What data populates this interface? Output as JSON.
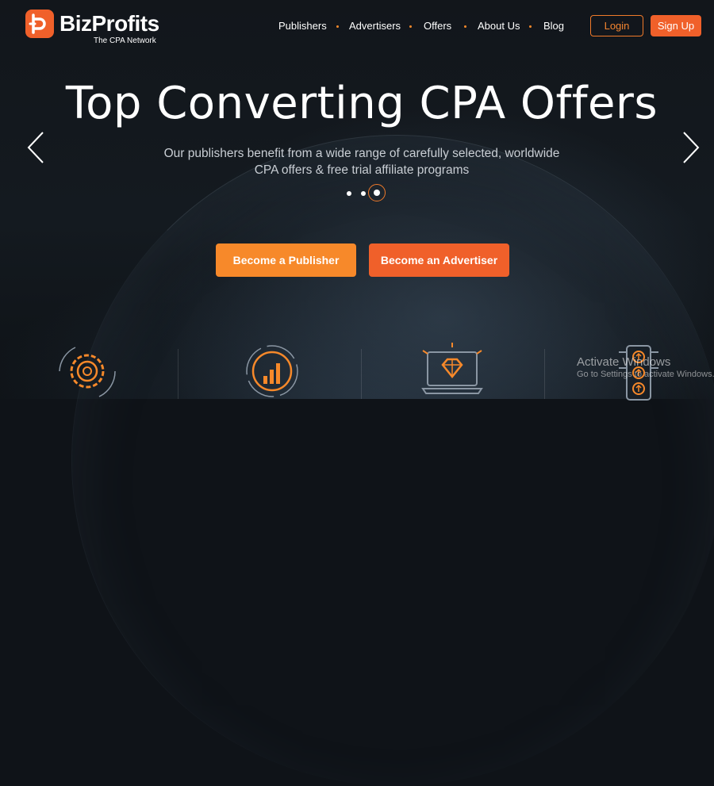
{
  "header": {
    "logo_name": "BizProfits",
    "logo_tagline": "The CPA Network",
    "nav": [
      "Publishers",
      "Advertisers",
      "Offers",
      "About Us",
      "Blog"
    ],
    "login_label": "Login",
    "signup_label": "Sign Up"
  },
  "hero": {
    "title": "Top Converting CPA Offers",
    "subtitle": "Our publishers benefit from a wide range of carefully selected, worldwide CPA offers & free trial affiliate programs",
    "slide_count": 3,
    "active_slide": 3
  },
  "cta": {
    "publisher_label": "Become a Publisher",
    "advertiser_label": "Become an Advertiser"
  },
  "features": {
    "icons": [
      "gear-icon",
      "chart-target-icon",
      "laptop-diamond-icon",
      "traffic-light-icon"
    ]
  },
  "os_watermark": {
    "title": "Activate Windows",
    "subtitle": "Go to Settings to activate Windows."
  },
  "colors": {
    "accent_orange": "#f7892a",
    "accent_red_orange": "#f0602a",
    "background": "#12161b"
  }
}
